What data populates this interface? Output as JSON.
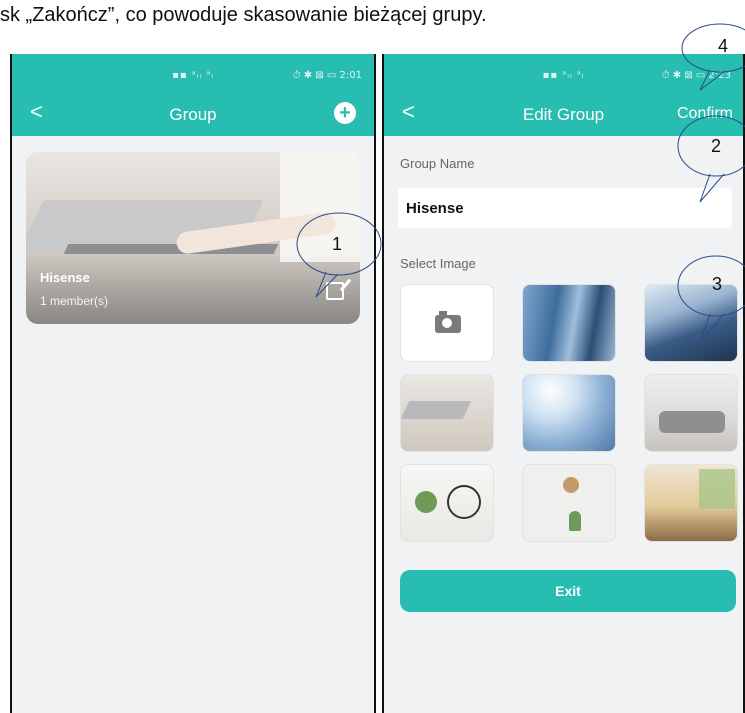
{
  "caption": "sk „Zakończ”, co powoduje skasowanie bieżącej grupy.",
  "colors": {
    "accent": "#27bdb1",
    "background": "#f0f2f4"
  },
  "left_screen": {
    "status_signal": "▪▪ ᵃᵢₗ ᵃₗ",
    "status_right": "⏱ ✱ ⊠ ▭ 2:01",
    "nav": {
      "back_icon": "chevron-left-icon",
      "back": "<",
      "title": "Group",
      "add_icon": "plus-circle-icon",
      "add": "+"
    },
    "group_card": {
      "name": "Hisense",
      "members": "1 member(s)",
      "edit_icon": "edit-icon"
    }
  },
  "right_screen": {
    "status_signal": "▪▪ ᵃᵢₗ ᵃₗ",
    "status_right": "⏱ ✱ ⊠ ▭ 2:23",
    "nav": {
      "back": "<",
      "title": "Edit Group",
      "confirm": "Confirm"
    },
    "group_name_label": "Group Name",
    "group_name_value": "Hisense",
    "select_image_label": "Select Image",
    "images": [
      {
        "name": "camera-icon"
      },
      {
        "name": "building-glass"
      },
      {
        "name": "building-corner"
      },
      {
        "name": "laptop-desk"
      },
      {
        "name": "sky-towers"
      },
      {
        "name": "sofa-room"
      },
      {
        "name": "plant-basket"
      },
      {
        "name": "wall-clock"
      },
      {
        "name": "bookshelf"
      }
    ],
    "exit_button": "Exit"
  },
  "callouts": [
    "1",
    "2",
    "3",
    "4"
  ]
}
